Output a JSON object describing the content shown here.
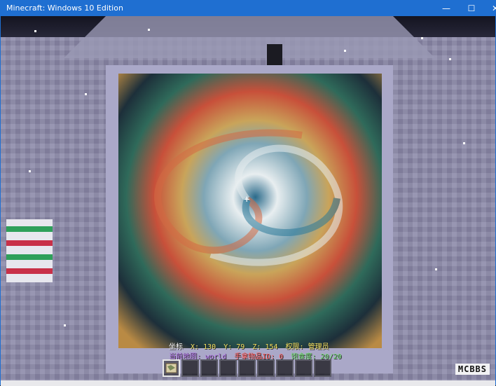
{
  "window": {
    "title": "Minecraft: Windows 10 Edition",
    "controls": [
      "—",
      "☐",
      "✕"
    ]
  },
  "hud": {
    "coords_label": "坐标",
    "x_label": "X:",
    "x_value": "130",
    "y_label": "Y:",
    "y_value": "79",
    "z_label": "Z:",
    "z_value": "154",
    "permission_label": "权限:",
    "permission_value": "管理员",
    "map_label": "当前地图:",
    "map_value": "world",
    "hand_item_label": "手拿物品ID:",
    "hand_item_value": "0",
    "hunger_label": "饱食度:",
    "hunger_value": "20/20"
  },
  "hotbar": {
    "slot_count": 9,
    "selected_slot": 1
  },
  "watermark": "MCBBS",
  "colors": {
    "titlebar": "#1f6fd1",
    "coords_yellow": "#f0e060",
    "coords_label_white": "#ffffff",
    "map_purple": "#b070e8",
    "hand_item_red": "#ff5a5a",
    "hunger_green": "#6fe06f"
  }
}
